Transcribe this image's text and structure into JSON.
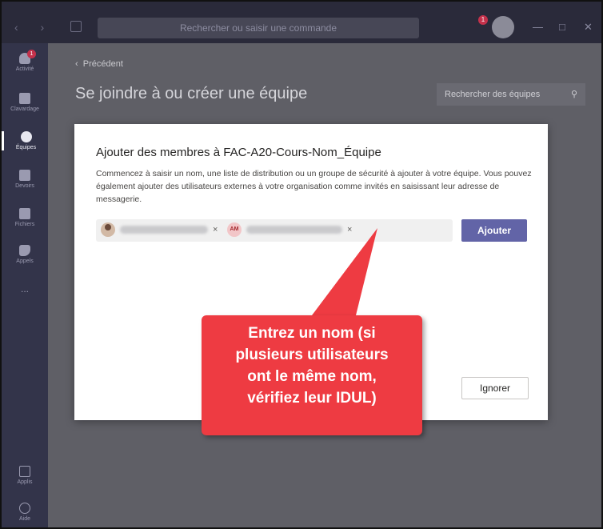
{
  "titlebar": {
    "search_placeholder": "Rechercher ou saisir une commande",
    "notification_count": "1",
    "window_minimize": "—",
    "window_maximize": "□",
    "window_close": "✕"
  },
  "rail": {
    "items": [
      {
        "label": "Activité",
        "icon": "bell-icon",
        "badge": "1"
      },
      {
        "label": "Clavardage",
        "icon": "chat-icon"
      },
      {
        "label": "Équipes",
        "icon": "teams-icon"
      },
      {
        "label": "Devoirs",
        "icon": "assignments-icon"
      },
      {
        "label": "Fichiers",
        "icon": "files-icon"
      },
      {
        "label": "Appels",
        "icon": "phone-icon"
      },
      {
        "label": "...",
        "icon": "more-icon"
      }
    ],
    "bottom_items": [
      {
        "label": "Applis",
        "icon": "apps-icon"
      },
      {
        "label": "Aide",
        "icon": "help-icon"
      }
    ]
  },
  "main": {
    "back_label": "Précédent",
    "heading": "Se joindre à ou créer une équipe",
    "team_search_placeholder": "Rechercher des équipes"
  },
  "dialog": {
    "title": "Ajouter des membres à FAC-A20-Cours-Nom_Équipe",
    "description": "Commencez à saisir un nom, une liste de distribution ou un groupe de sécurité à ajouter à votre équipe. Vous pouvez également ajouter des utilisateurs externes à votre organisation comme invités en saisissant leur adresse de messagerie.",
    "chips": [
      {
        "initials": "",
        "remove": "×"
      },
      {
        "initials": "AM",
        "remove": "×"
      }
    ],
    "add_button": "Ajouter",
    "ignore_button": "Ignorer"
  },
  "callout": {
    "lines": [
      "Entrez un nom (si",
      "plusieurs utilisateurs",
      "ont le même nom,",
      "vérifiez leur IDUL)"
    ]
  },
  "colors": {
    "accent": "#6264a7",
    "callout": "#ee3b42",
    "rail": "#33344a"
  }
}
